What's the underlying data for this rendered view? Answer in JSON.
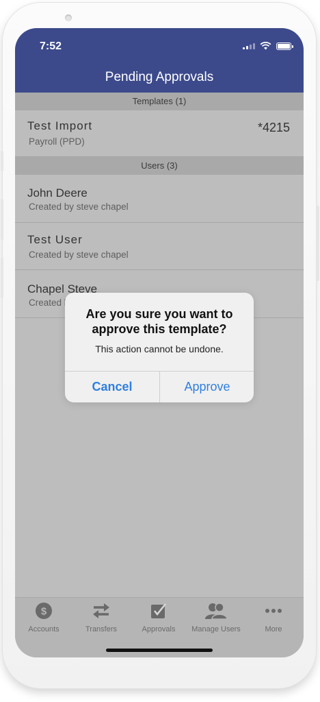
{
  "status_bar": {
    "time": "7:52"
  },
  "header": {
    "title": "Pending Approvals"
  },
  "sections": {
    "templates": {
      "header": "Templates (1)",
      "items": [
        {
          "title": "Test Import",
          "subtitle": "Payroll (PPD)",
          "account": "*4215"
        }
      ]
    },
    "users": {
      "header": "Users (3)",
      "items": [
        {
          "name": "John Deere",
          "subtitle": "Created by steve chapel"
        },
        {
          "name": "Test User",
          "subtitle": "Created by steve chapel"
        },
        {
          "name": "Chapel Steve",
          "subtitle": "Created by steve chapel"
        }
      ]
    }
  },
  "dialog": {
    "title": "Are you sure you want to approve this template?",
    "message": "This action cannot be undone.",
    "cancel_label": "Cancel",
    "approve_label": "Approve"
  },
  "tabbar": {
    "tabs": [
      {
        "label": "Accounts",
        "icon": "dollar-circle-icon"
      },
      {
        "label": "Transfers",
        "icon": "transfer-arrows-icon"
      },
      {
        "label": "Approvals",
        "icon": "checkbox-icon"
      },
      {
        "label": "Manage Users",
        "icon": "users-icon"
      },
      {
        "label": "More",
        "icon": "ellipsis-icon"
      }
    ]
  },
  "colors": {
    "header_bg": "#3c4a8c",
    "link_blue": "#2f7fe0",
    "overlay_gray": "#bdbdbd",
    "section_gray": "#a9a9a9"
  }
}
